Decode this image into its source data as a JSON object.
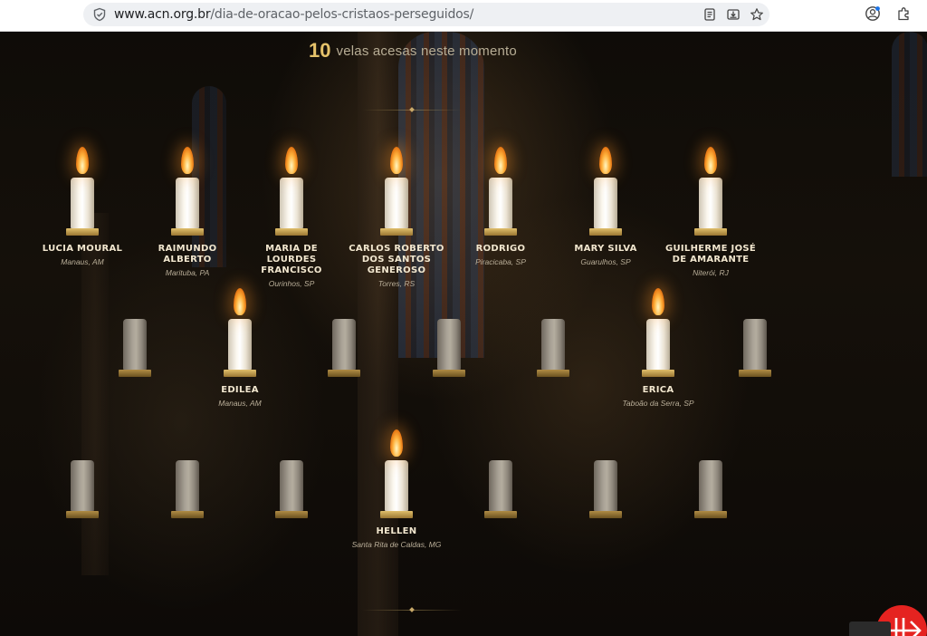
{
  "browser": {
    "url_host": "www.acn.org.br",
    "url_path": "/dia-de-oracao-pelos-cristaos-perseguidos/"
  },
  "counter": {
    "number": "10",
    "text": "velas acesas neste momento"
  },
  "candles": [
    {
      "lit": true,
      "name": "LUCIA MOURAL",
      "location": "Manaus, AM"
    },
    {
      "lit": true,
      "name": "RAIMUNDO ALBERTO",
      "location": "Marituba, PA"
    },
    {
      "lit": true,
      "name": "MARIA DE LOURDES FRANCISCO",
      "location": "Ourinhos, SP"
    },
    {
      "lit": true,
      "name": "CARLOS ROBERTO DOS SANTOS GENEROSO",
      "location": "Torres, RS"
    },
    {
      "lit": true,
      "name": "RODRIGO",
      "location": "Piracicaba, SP"
    },
    {
      "lit": true,
      "name": "MARY SILVA",
      "location": "Guarulhos, SP"
    },
    {
      "lit": true,
      "name": "GUILHERME JOSÉ DE AMARANTE",
      "location": "Niterói, RJ"
    },
    {
      "lit": false,
      "name": "",
      "location": ""
    },
    {
      "lit": true,
      "name": "EDILEA",
      "location": "Manaus, AM"
    },
    {
      "lit": false,
      "name": "",
      "location": ""
    },
    {
      "lit": false,
      "name": "",
      "location": ""
    },
    {
      "lit": false,
      "name": "",
      "location": ""
    },
    {
      "lit": true,
      "name": "ERICA",
      "location": "Taboão da Serra, SP"
    },
    {
      "lit": false,
      "name": "",
      "location": ""
    },
    {
      "lit": false,
      "name": "",
      "location": ""
    },
    {
      "lit": false,
      "name": "",
      "location": ""
    },
    {
      "lit": false,
      "name": "",
      "location": ""
    },
    {
      "lit": true,
      "name": "HELLEN",
      "location": "Santa Rita de Caldas, MG"
    },
    {
      "lit": false,
      "name": "",
      "location": ""
    },
    {
      "lit": false,
      "name": "",
      "location": ""
    },
    {
      "lit": false,
      "name": "",
      "location": ""
    }
  ],
  "colors": {
    "accent_gold": "#e5c26a",
    "fab_red": "#e52320"
  }
}
